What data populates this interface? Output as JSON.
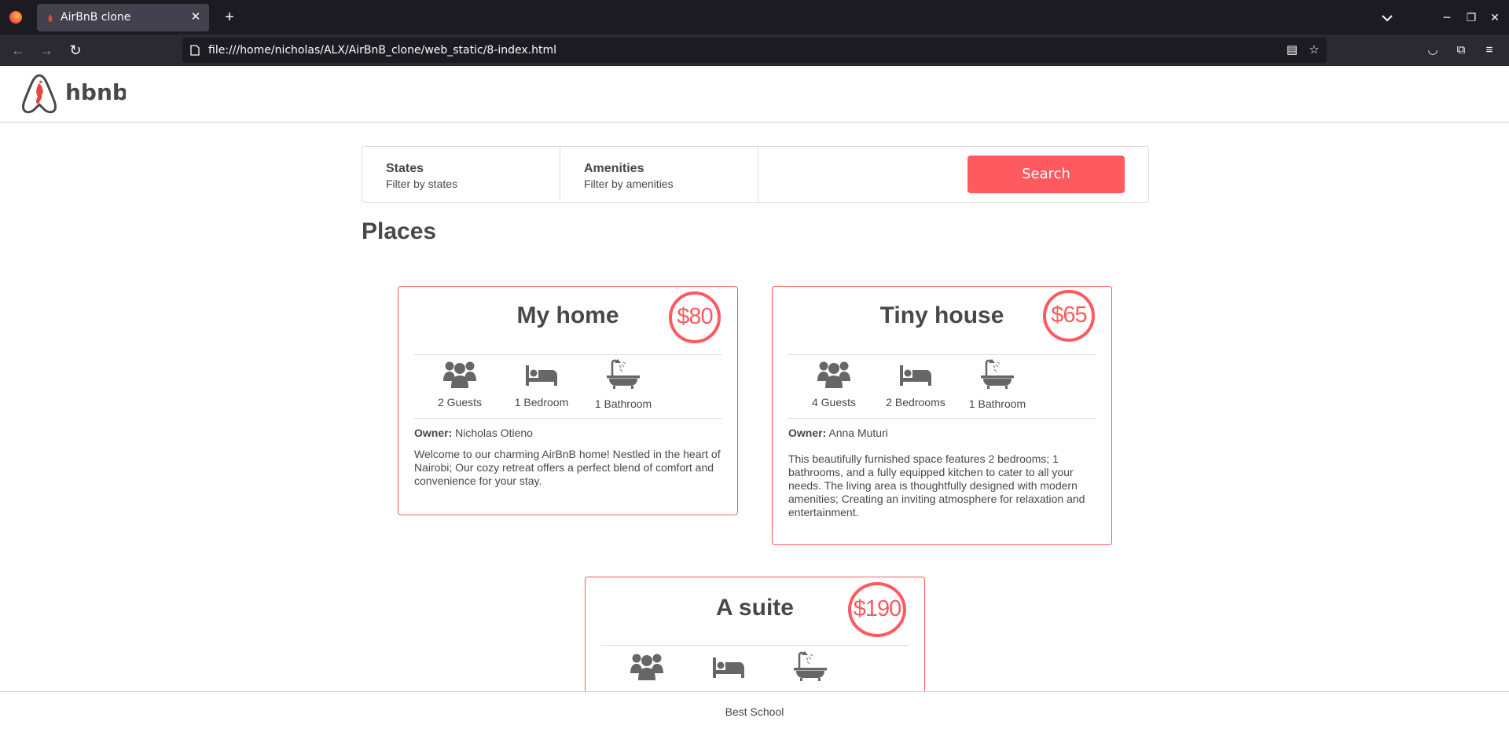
{
  "browser": {
    "tab_title": "AirBnB clone",
    "url": "file:///home/nicholas/ALX/AirBnB_clone/web_static/8-index.html",
    "icons": [
      "firefox-icon",
      "tab-close-icon",
      "new-tab-icon",
      "tab-list-icon",
      "minimize-icon",
      "restore-icon",
      "close-window-icon",
      "back-icon",
      "forward-icon",
      "reload-icon",
      "page-icon",
      "reader-view-icon",
      "bookmark-star-icon",
      "pocket-icon",
      "extensions-icon",
      "menu-icon"
    ]
  },
  "header": {
    "logo_text": "hbnb"
  },
  "filters": {
    "states_title": "States",
    "states_sub": "Filter by states",
    "amenities_title": "Amenities",
    "amenities_sub": "Filter by amenities",
    "search_label": "Search"
  },
  "places_title": "Places",
  "places": [
    {
      "title": "My home",
      "price": "$80",
      "guests": "2 Guests",
      "rooms": "1 Bedroom",
      "baths": "1 Bathroom",
      "owner_label": "Owner:",
      "owner": "Nicholas Otieno",
      "description": "Welcome to our charming AirBnB home! Nestled in the heart of Nairobi; Our cozy retreat offers a perfect blend of comfort and convenience for your stay."
    },
    {
      "title": "Tiny house",
      "price": "$65",
      "guests": "4 Guests",
      "rooms": "2 Bedrooms",
      "baths": "1 Bathroom",
      "owner_label": "Owner:",
      "owner": "Anna Muturi",
      "description": "This beautifully furnished space features 2 bedrooms; 1 bathrooms, and a fully equipped kitchen to cater to all your needs. The living area is thoughtfully designed with modern amenities; Creating an inviting atmosphere for relaxation and entertainment."
    },
    {
      "title": "A suite",
      "price": "$190"
    }
  ],
  "footer": {
    "text": "Best School"
  },
  "colors": {
    "accent": "#ff5a5f",
    "text": "#484848",
    "border": "#dddddd",
    "chrome_dark": "#1c1b22",
    "chrome_toolbar": "#2b2a33"
  }
}
